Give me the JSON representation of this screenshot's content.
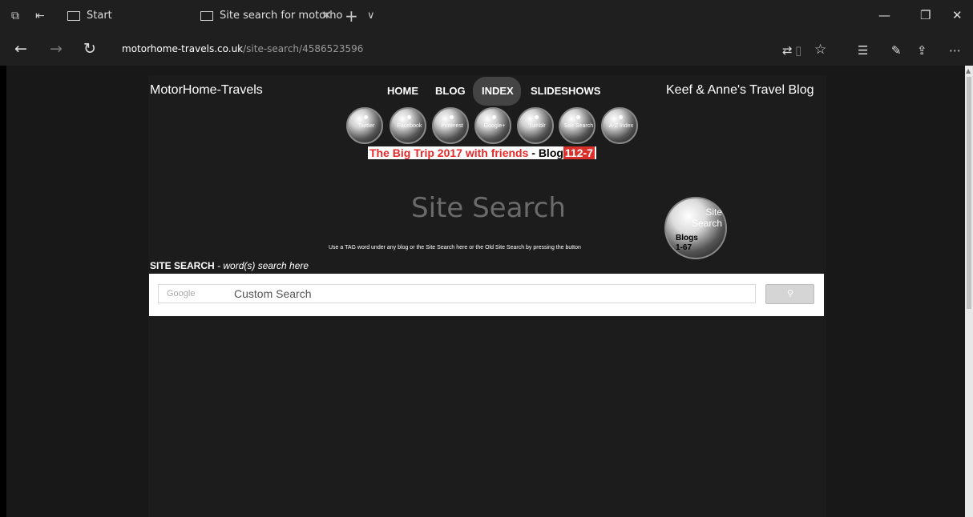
{
  "browser": {
    "tabs": [
      {
        "label": "Start"
      },
      {
        "label": "Site search for motorho"
      }
    ],
    "url_host": "motorhome-travels.co.uk",
    "url_path": "/site-search/4586523596"
  },
  "site": {
    "brand": "MotorHome-Travels",
    "tagline": "Keef & Anne's Travel Blog",
    "menu": [
      {
        "label": "HOME"
      },
      {
        "label": "BLOG"
      },
      {
        "label": "INDEX"
      },
      {
        "label": "SLIDESHOWS"
      }
    ],
    "social_buttons": [
      {
        "label": "Twitter"
      },
      {
        "label": "Facebook"
      },
      {
        "label": "Pinterest"
      },
      {
        "label": "Google+"
      },
      {
        "label": "Tumblr"
      },
      {
        "label": "Site Search"
      },
      {
        "label": "A-Z Index"
      }
    ],
    "banner": {
      "part1": "The Big Trip 2017 with friends",
      "part2": " - Blog",
      "part3": "112-7"
    },
    "hero_title": "Site Search",
    "hero_button": {
      "line1": "Site",
      "line2": "Search",
      "line3": "Blogs",
      "line4": "1-67"
    },
    "note": "Use a TAG word under any blog or the Site Search here or the Old Site Search by pressing the button",
    "search_label_bold": "SITE SEARCH",
    "search_label_italic": " - word(s) search here",
    "search": {
      "brand": "Google",
      "placeholder": "Custom Search"
    }
  }
}
